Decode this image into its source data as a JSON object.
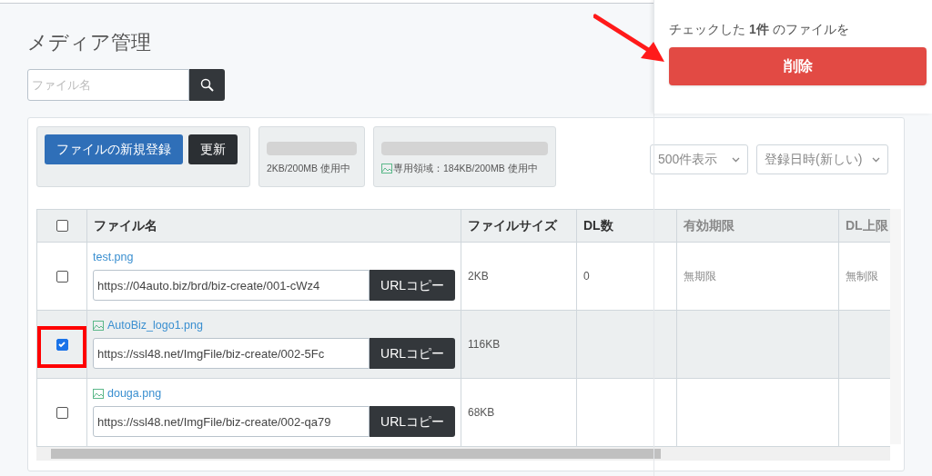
{
  "page": {
    "title": "メディア管理"
  },
  "search": {
    "placeholder": "ファイル名"
  },
  "toolbar": {
    "buttons": [
      {
        "label": "ファイルの新規登録",
        "kind": "primary"
      },
      {
        "label": "更新",
        "kind": "dark"
      }
    ],
    "storage": [
      {
        "text": "2KB/200MB 使用中",
        "icon": false
      },
      {
        "text": "専用領域：184KB/200MB 使用中",
        "icon": true
      }
    ],
    "selects": [
      {
        "value": "500件表示"
      },
      {
        "value": "登録日時(新しい)"
      }
    ]
  },
  "table": {
    "header_checked": false,
    "columns": [
      "ファイル名",
      "ファイルサイズ",
      "DL数",
      "有効期限",
      "DL上限"
    ],
    "rows": [
      {
        "checked": false,
        "highlighted": false,
        "icon": false,
        "name": "test.png",
        "url": "https://04auto.biz/brd/biz-create/001-cWz4",
        "copy": "URLコピー",
        "size": "2KB",
        "dl": "0",
        "expiry": "無期限",
        "limit": "無制限"
      },
      {
        "checked": true,
        "highlighted": true,
        "icon": true,
        "name": "AutoBiz_logo1.png",
        "url": "https://ssl48.net/ImgFile/biz-create/002-5Fc",
        "copy": "URLコピー",
        "size": "116KB",
        "dl": "",
        "expiry": "",
        "limit": ""
      },
      {
        "checked": false,
        "highlighted": false,
        "icon": true,
        "name": "douga.png",
        "url": "https://ssl48.net/ImgFile/biz-create/002-qa79",
        "copy": "URLコピー",
        "size": "68KB",
        "dl": "",
        "expiry": "",
        "limit": ""
      }
    ]
  },
  "delete_panel": {
    "message": "チェックした **1件** のファイルを",
    "button": "削除"
  }
}
